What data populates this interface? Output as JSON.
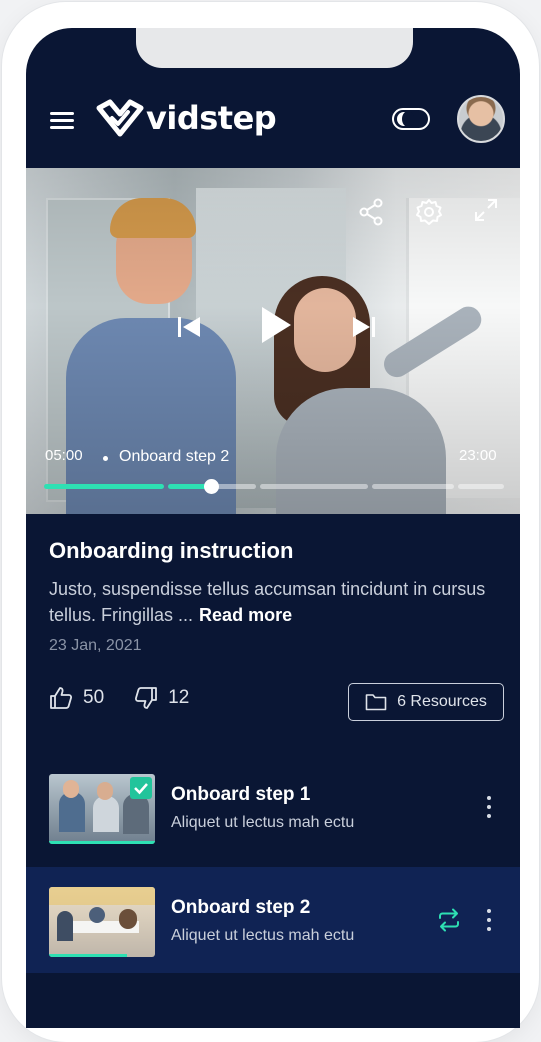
{
  "app": {
    "brand": "vidstep"
  },
  "video": {
    "current_time": "05:00",
    "total_time": "23:00",
    "step_label": "Onboard step 2",
    "progress_fraction": 0.33
  },
  "content": {
    "title": "Onboarding instruction",
    "description": "Justo, suspendisse tellus accumsan tincidunt in cursus tellus. Fringillas ...",
    "read_more": "Read more",
    "date": "23 Jan, 2021",
    "likes": "50",
    "dislikes": "12",
    "resources_label": "6 Resources"
  },
  "steps": [
    {
      "title": "Onboard step 1",
      "subtitle": "Aliquet ut lectus mah ectu",
      "completed": true
    },
    {
      "title": "Onboard step 2",
      "subtitle": "Aliquet ut lectus mah ectu",
      "active": true
    }
  ],
  "colors": {
    "background": "#0a1634",
    "accent": "#2ee0b3",
    "active_row": "#102354"
  }
}
